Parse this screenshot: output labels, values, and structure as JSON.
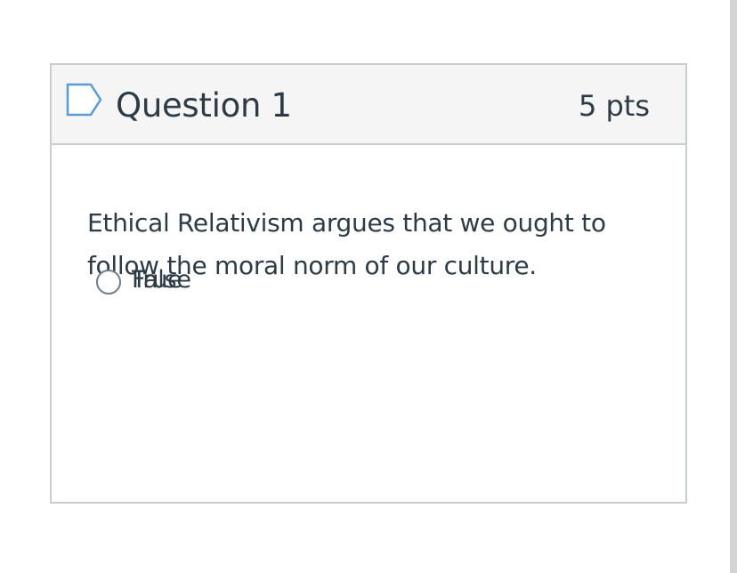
{
  "question": {
    "title": "Question 1",
    "points": "5 pts",
    "flag_icon": "flag-question-icon",
    "text": "Ethical Relativism argues that we ought to follow the moral norm of our culture.",
    "answers": [
      {
        "label": "True"
      },
      {
        "label": "False"
      }
    ]
  },
  "colors": {
    "header_bg": "#f5f5f5",
    "border": "#c7cdd1",
    "text": "#2d3b45",
    "flag": "#5b9bd5"
  }
}
